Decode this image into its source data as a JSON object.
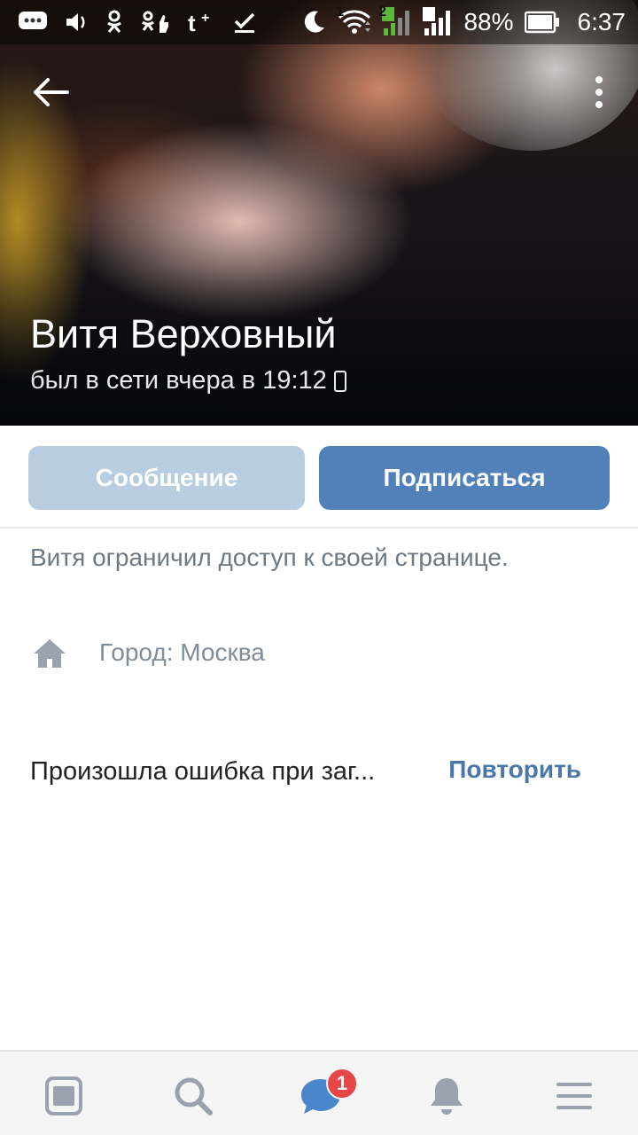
{
  "status_bar": {
    "battery": "88%",
    "time": "6:37",
    "sim1": "1",
    "sim2": "2",
    "notification_icons": [
      "message-icon",
      "volume-icon",
      "odnoklassniki-icon",
      "ok-likes-icon",
      "tumblr-icon",
      "download-done-icon"
    ],
    "system_icons": [
      "night-mode-icon",
      "wifi-icon",
      "signal-sim1-icon",
      "signal-sim2-icon",
      "battery-icon"
    ]
  },
  "profile": {
    "name": "Витя Верховный",
    "last_seen": "был в сети вчера в 19:12",
    "restricted_notice": "Витя ограничил доступ к своей странице.",
    "city": "Город: Москва"
  },
  "actions": {
    "message_label": "Сообщение",
    "subscribe_label": "Подписаться"
  },
  "error": {
    "text": "Произошла ошибка при заг...",
    "retry_label": "Повторить"
  },
  "bottom_nav": {
    "items": [
      "news-icon",
      "search-icon",
      "messages-icon",
      "notifications-icon",
      "menu-icon"
    ],
    "messages_badge": "1"
  },
  "colors": {
    "accent": "#5181b8",
    "accent_disabled": "#b8cde0",
    "link": "#4a76a8",
    "badge": "#e64646",
    "secondary_text": "#818c99"
  }
}
